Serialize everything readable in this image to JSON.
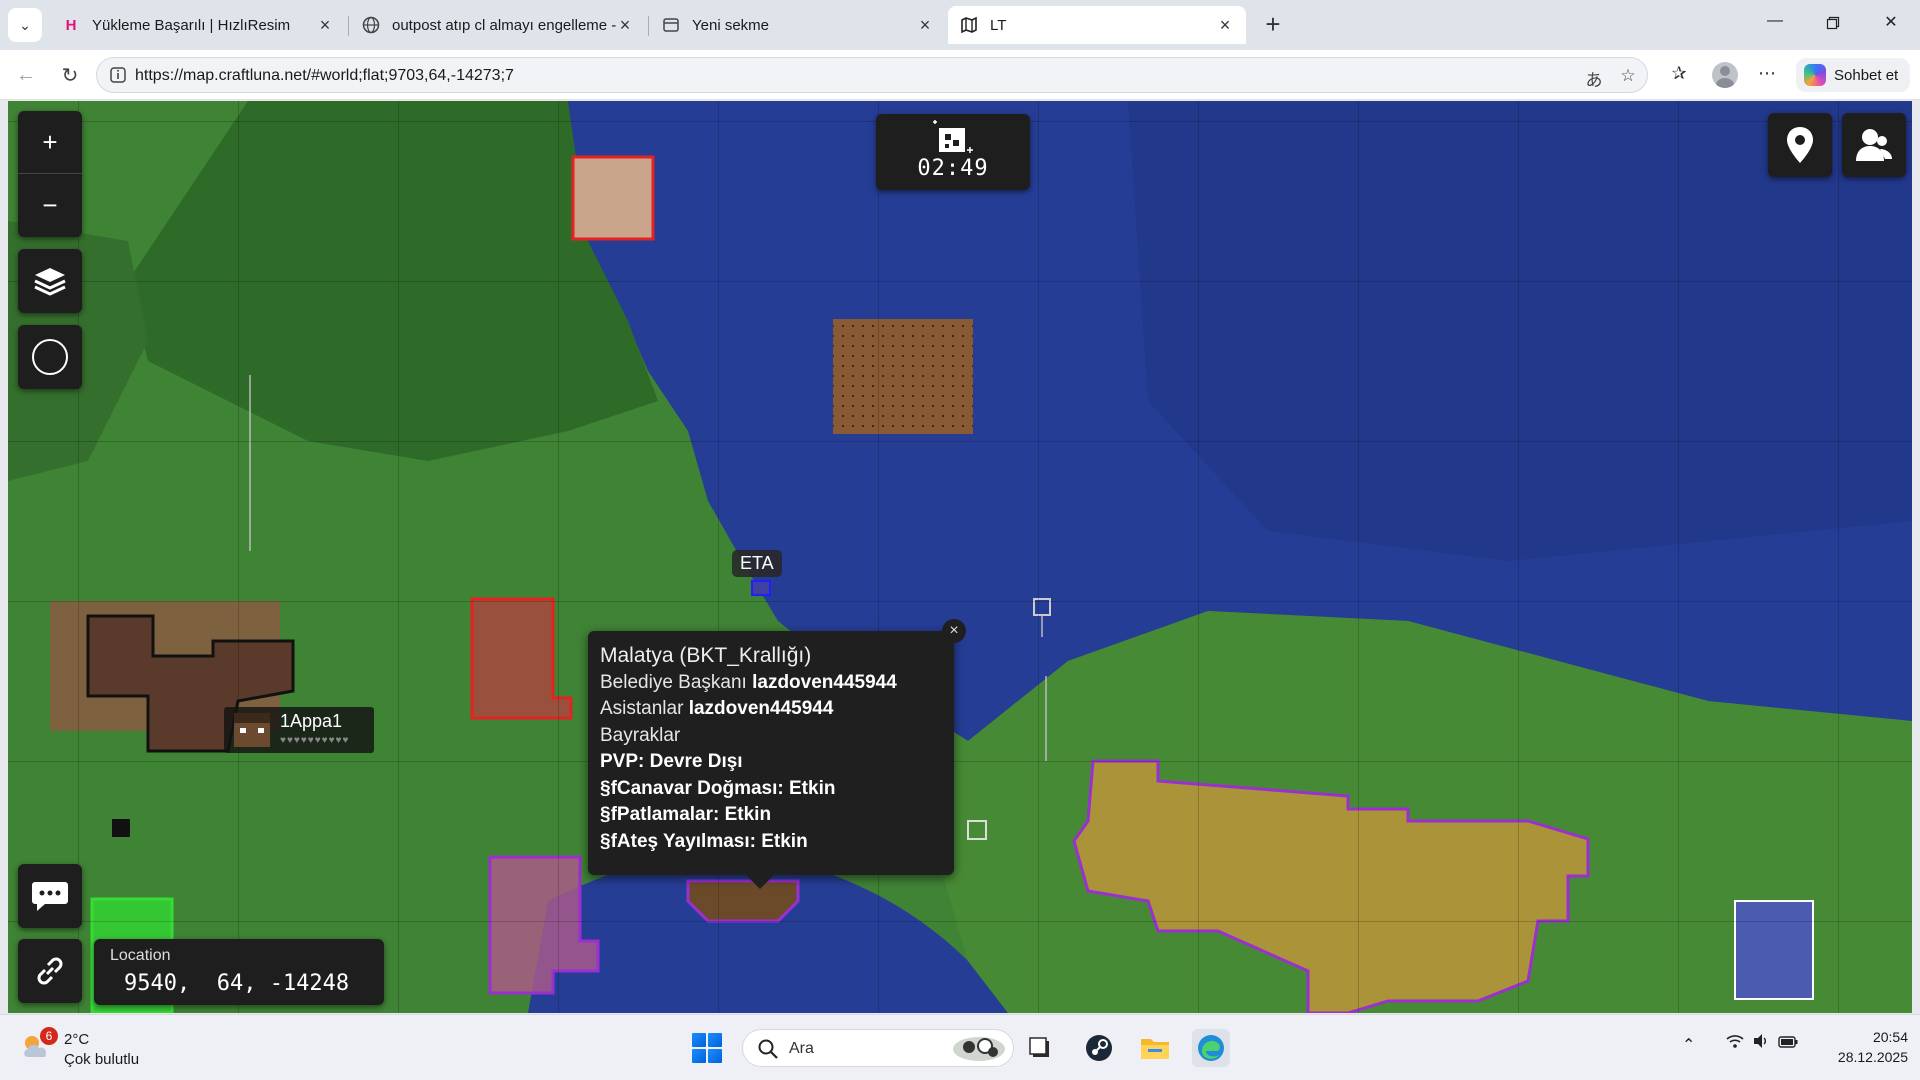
{
  "browser": {
    "tabs": [
      {
        "title": "Yükleme Başarılı | HızlıResim",
        "active": false
      },
      {
        "title": "outpost atıp cl almayı engelleme -",
        "active": false
      },
      {
        "title": "Yeni sekme",
        "active": false
      },
      {
        "title": "LT",
        "active": true
      }
    ],
    "new_tab_symbol": "+",
    "url": "https://map.craftluna.net/#world;flat;9703,64,-14273;7",
    "copilot_label": "Sohbet et"
  },
  "map": {
    "clock": "02:49",
    "eta_label": "ETA",
    "player": {
      "name": "1Appa1"
    },
    "popup": {
      "title": "Malatya (BKT_Krallığı)",
      "mayor_label": "Belediye Başkanı",
      "mayor": "lazdoven445944",
      "assistants_label": "Asistanlar",
      "assistants": "lazdoven445944",
      "flags_label": "Bayraklar",
      "pvp": "PVP: Devre Dışı",
      "mob_spawn": "§fCanavar Doğması: Etkin",
      "explosions": "§fPatlamalar: Etkin",
      "fire_spread": "§fAteş Yayılması: Etkin"
    },
    "location": {
      "label": "Location",
      "value": "9540,  64, -14248"
    },
    "controls": {
      "zoom_in": "+",
      "zoom_out": "−"
    },
    "colors": {
      "land": "#3f8335",
      "water": "#263d95",
      "claim_red": "#e52222",
      "claim_purple": "#9b2fd0",
      "claim_green": "#33dd33"
    }
  },
  "taskbar": {
    "weather_badge": "6",
    "temperature": "2°C",
    "condition": "Çok bulutlu",
    "search_label": "Ara",
    "time": "20:54",
    "date": "28.12.2025"
  }
}
